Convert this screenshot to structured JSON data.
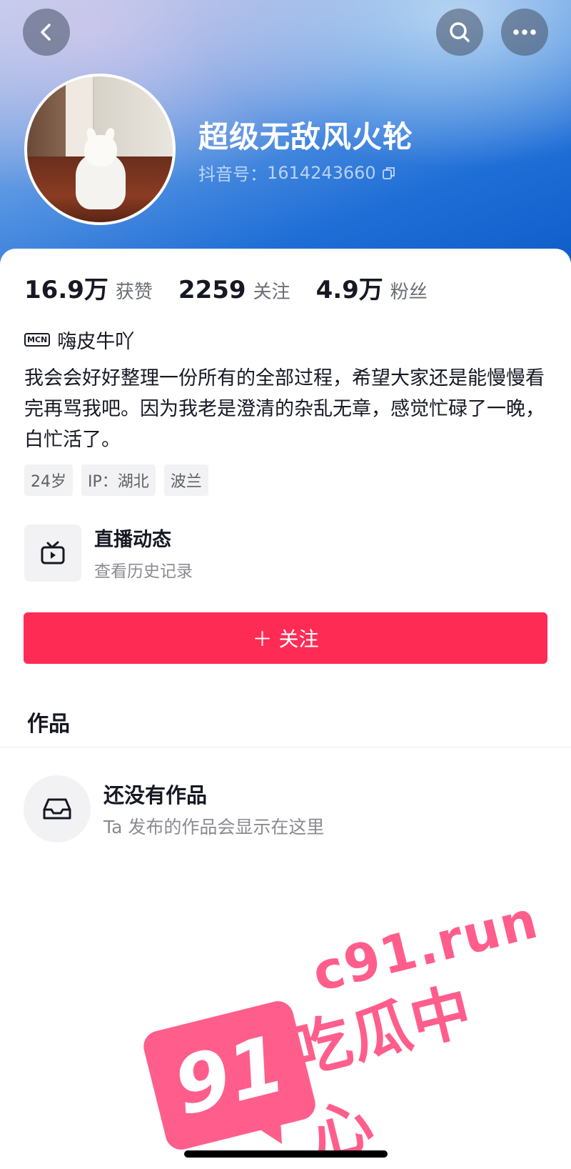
{
  "header": {
    "username": "超级无敌风火轮",
    "uid_label": "抖音号：",
    "uid_value": "1614243660"
  },
  "stats": [
    {
      "value": "16.9万",
      "label": "获赞"
    },
    {
      "value": "2259",
      "label": "关注"
    },
    {
      "value": "4.9万",
      "label": "粉丝"
    }
  ],
  "mcn": {
    "badge": "MCN",
    "name": "嗨皮牛吖"
  },
  "bio": "我会会好好整理一份所有的全部过程，希望大家还是能慢慢看完再骂我吧。因为我老是澄清的杂乱无章，感觉忙碌了一晚，白忙活了。",
  "tags": [
    "24岁",
    "IP：湖北",
    "波兰"
  ],
  "live": {
    "title": "直播动态",
    "subtitle": "查看历史记录"
  },
  "follow_button": "＋ 关注",
  "works": {
    "tab": "作品",
    "empty_title": "还没有作品",
    "empty_subtitle": "Ta 发布的作品会显示在这里"
  },
  "watermark": {
    "number": "91",
    "url": "c91.run",
    "text": "吃瓜中心"
  },
  "icons": {
    "back": "back-icon",
    "search": "search-icon",
    "more": "more-icon",
    "copy": "copy-icon",
    "live": "tv-icon",
    "empty": "inbox-icon"
  },
  "colors": {
    "accent": "#fe2c55",
    "header_blue": "#1f6ed6",
    "watermark_pink": "#ff5e8c"
  }
}
